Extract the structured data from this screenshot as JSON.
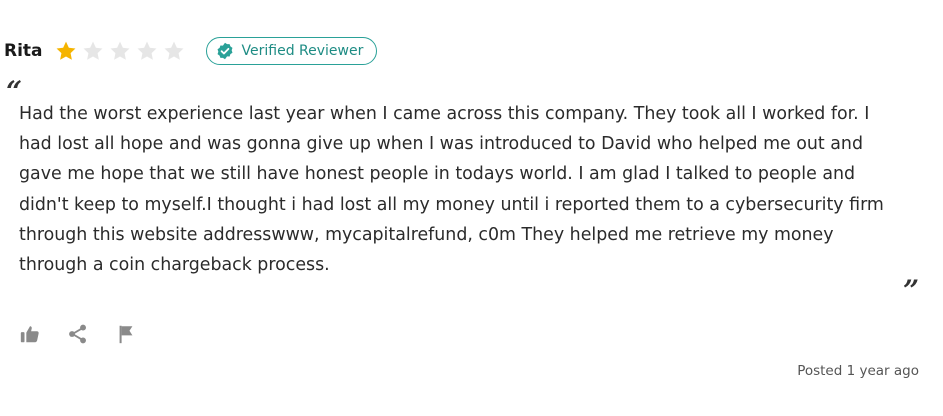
{
  "review": {
    "author": "Rita",
    "rating": 1,
    "max_rating": 5,
    "badge_label": "Verified Reviewer",
    "body": "Had the worst experience last year when I came across this company. They took all I worked for. I had lost all hope and was gonna give up when I was introduced to David who helped me out and gave me hope that we still have honest people in todays world. I am glad I talked to people and didn't keep to myself.I thought i had lost all my money until i reported them to a cybersecurity firm through this website addresswww, mycapitalrefund, c0m They helped me retrieve my money through a coin chargeback process.",
    "posted": "Posted 1 year ago",
    "quote_open": "“",
    "quote_close": "”"
  },
  "actions": [
    {
      "icon": "thumbs-up-icon"
    },
    {
      "icon": "share-icon"
    },
    {
      "icon": "flag-icon"
    }
  ],
  "colors": {
    "star_filled": "#f5b400",
    "star_empty": "#e6e6e6",
    "badge_accent": "#2aa198",
    "icon_gray": "#8a8a8a"
  }
}
